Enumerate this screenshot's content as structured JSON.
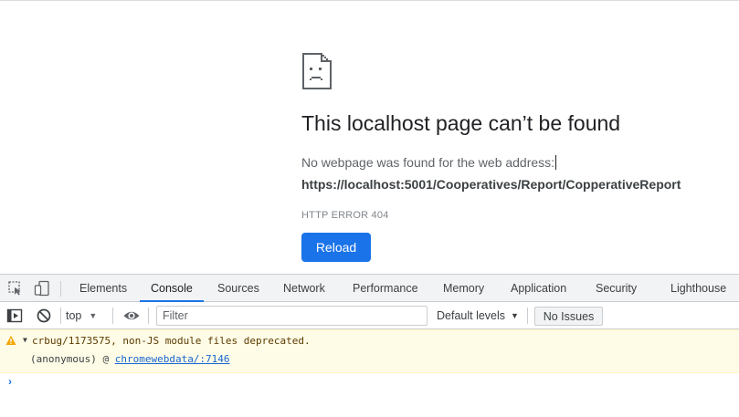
{
  "error_page": {
    "title": "This localhost page can’t be found",
    "description": "No webpage was found for the web address:",
    "url": "https://localhost:5001/Cooperatives/Report/CopperativeReport",
    "code": "HTTP ERROR 404",
    "reload_label": "Reload",
    "icon": "sad-document-icon"
  },
  "devtools": {
    "tabs": [
      "Elements",
      "Console",
      "Sources",
      "Network",
      "Performance",
      "Memory",
      "Application",
      "Security",
      "Lighthouse"
    ],
    "active_tab": "Console",
    "toolbar": {
      "context": "top",
      "filter_placeholder": "Filter",
      "levels_label": "Default levels",
      "issues_label": "No Issues"
    },
    "console": {
      "warning_message": "crbug/1173575, non-JS module files deprecated.",
      "stack_prefix": "(anonymous) @ ",
      "stack_link": "chromewebdata/:7146",
      "prompt_symbol": "›"
    }
  },
  "colors": {
    "accent": "#1a73e8",
    "warning_bg": "#fefbe6",
    "warning_icon": "#f2a600"
  }
}
